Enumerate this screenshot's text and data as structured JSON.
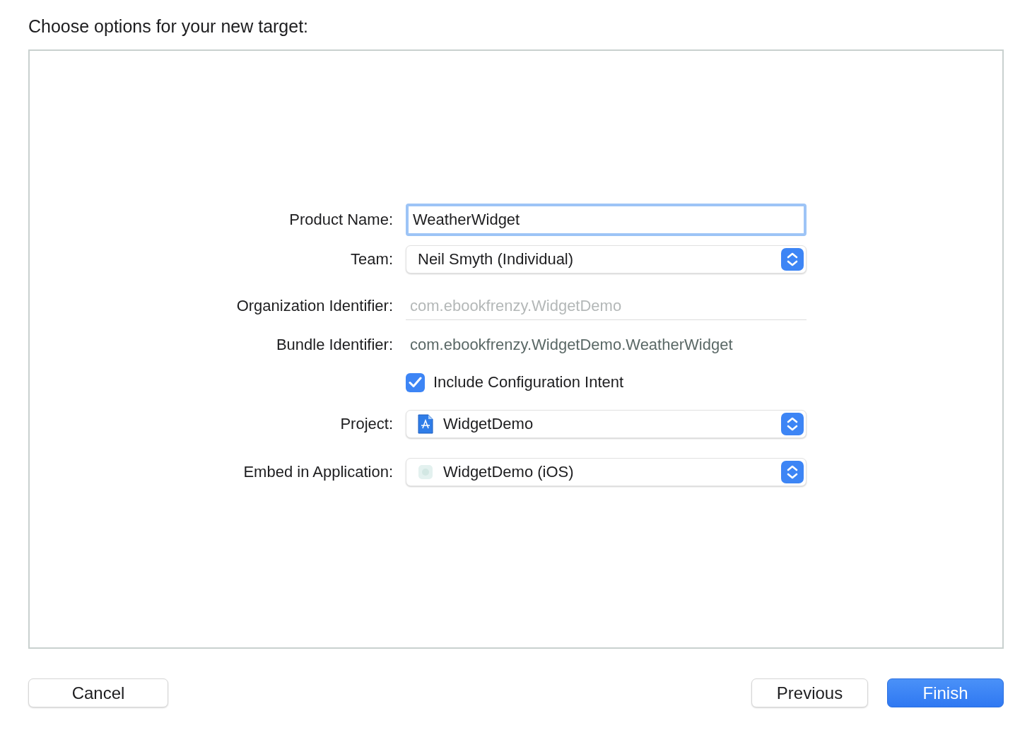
{
  "title": "Choose options for your new target:",
  "fields": [
    {
      "kind": "text",
      "label": "Product Name:",
      "value": "WeatherWidget",
      "focused": true
    },
    {
      "kind": "popup",
      "label": "Team:",
      "value": "Neil Smyth (Individual)"
    },
    {
      "kind": "text",
      "label": "Organization Identifier:",
      "placeholder": "com.ebookfrenzy.WidgetDemo",
      "focused": false
    },
    {
      "kind": "static",
      "label": "Bundle Identifier:",
      "value": "com.ebookfrenzy.WidgetDemo.WeatherWidget"
    },
    {
      "kind": "checkbox",
      "label": "Include Configuration Intent",
      "checked": true
    },
    {
      "kind": "popup",
      "label": "Project:",
      "value": "WidgetDemo"
    },
    {
      "kind": "popup",
      "label": "Embed in Application:",
      "value": "WidgetDemo (iOS)"
    }
  ],
  "buttons": [
    {
      "label": "Cancel",
      "default": false
    },
    {
      "label": "Previous",
      "default": false
    },
    {
      "label": "Finish",
      "default": true
    }
  ]
}
